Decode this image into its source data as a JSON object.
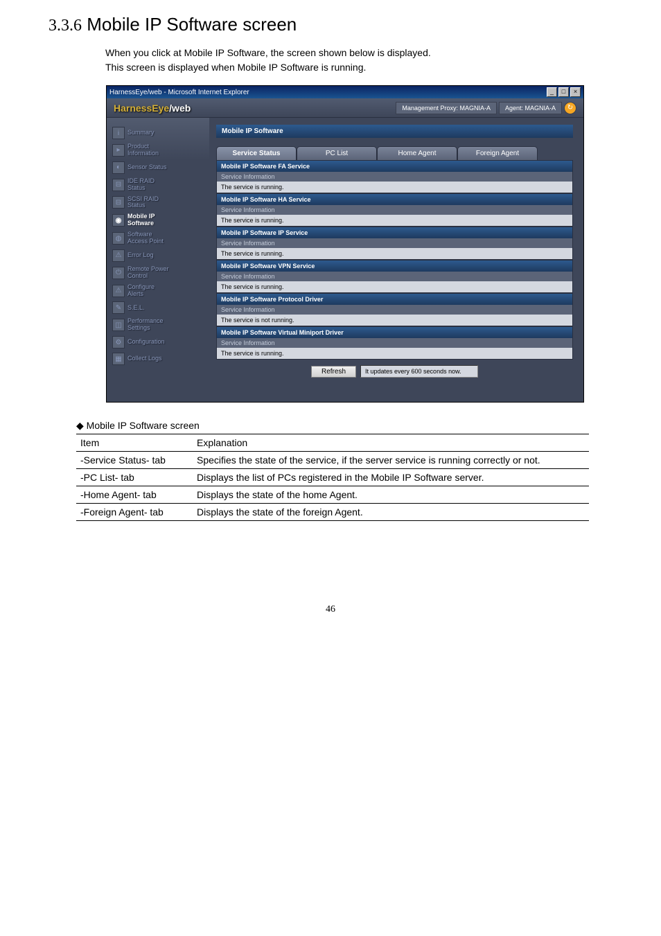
{
  "heading": {
    "number": "3.3.6",
    "title": "Mobile IP Software screen"
  },
  "description": {
    "line1": "When you click at Mobile IP Software, the screen shown below is displayed.",
    "line2": "This screen is displayed when Mobile IP Software is running."
  },
  "window": {
    "title": "HarnessEye/web - Microsoft Internet Explorer",
    "logo_prefix": "HarnessEye",
    "logo_suffix": "/web",
    "proxy": "Management Proxy: MAGNIA-A",
    "agent": "Agent: MAGNIA-A",
    "min_btn": "_",
    "max_btn": "□",
    "close_btn": "×",
    "refresh_icon": "↻"
  },
  "sidebar": {
    "items": [
      {
        "label": "Summary",
        "icon": "i"
      },
      {
        "label": "Product\nInformation",
        "icon": "▸"
      },
      {
        "label": "Sensor Status",
        "icon": "◐"
      },
      {
        "label": "IDE RAID\nStatus",
        "icon": "⊟"
      },
      {
        "label": "SCSI RAID\nStatus",
        "icon": "⊟"
      },
      {
        "label": "Mobile IP\nSoftware",
        "icon": "◉"
      },
      {
        "label": "Software\nAccess Point",
        "icon": "◍"
      },
      {
        "label": "Error Log",
        "icon": "⚠"
      },
      {
        "label": "Remote Power\nControl",
        "icon": "⏻"
      },
      {
        "label": "Configure\nAlerts",
        "icon": "⚠"
      },
      {
        "label": "S.E.L.",
        "icon": "✎"
      },
      {
        "label": "Performance\nSettings",
        "icon": "◫"
      },
      {
        "label": "Configuration",
        "icon": "⚙"
      },
      {
        "label": "Collect Logs",
        "icon": "▦"
      }
    ]
  },
  "content": {
    "panel_title": "Mobile IP Software",
    "tabs": [
      "Service Status",
      "PC List",
      "Home Agent",
      "Foreign Agent"
    ],
    "info_label": "Service Information",
    "services": [
      {
        "name": "Mobile IP Software FA Service",
        "status": "The service is running."
      },
      {
        "name": "Mobile IP Software HA Service",
        "status": "The service is running."
      },
      {
        "name": "Mobile IP Software IP Service",
        "status": "The service is running."
      },
      {
        "name": "Mobile IP Software VPN Service",
        "status": "The service is running."
      },
      {
        "name": "Mobile IP Software Protocol Driver",
        "status": "The service is not running."
      },
      {
        "name": "Mobile IP Software Virtual Miniport Driver",
        "status": "The service is running."
      }
    ],
    "refresh_btn": "Refresh",
    "refresh_text": "It updates every 600 seconds now."
  },
  "def_heading": "◆ Mobile IP Software screen",
  "def_table": {
    "header": {
      "col1": "Item",
      "col2": "Explanation"
    },
    "rows": [
      {
        "item": "-Service Status- tab",
        "expl": "Specifies the state of the service, if the server service is running correctly or not."
      },
      {
        "item": "-PC List- tab",
        "expl": "Displays the list of PCs registered in the Mobile IP Software server."
      },
      {
        "item": "-Home Agent- tab",
        "expl": "Displays the state of the home Agent."
      },
      {
        "item": "-Foreign Agent- tab",
        "expl": "Displays the state of the foreign Agent."
      }
    ]
  },
  "page_number": "46"
}
